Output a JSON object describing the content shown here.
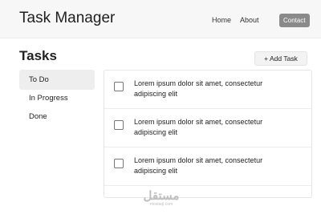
{
  "header": {
    "title": "Task Manager",
    "nav": {
      "home": "Home",
      "about": "About",
      "contact": "Contact"
    }
  },
  "page": {
    "title": "Tasks",
    "add_button": "+ Add Task"
  },
  "sidebar": {
    "items": [
      {
        "label": "To Do",
        "active": true
      },
      {
        "label": "In Progress",
        "active": false
      },
      {
        "label": "Done",
        "active": false
      }
    ]
  },
  "tasks": [
    {
      "text": "Lorem ipsum dolor sit amet, consectetur adipiscing elit",
      "done": false
    },
    {
      "text": "Lorem ipsum dolor sit amet, consectetur adipiscing elit",
      "done": false
    },
    {
      "text": "Lorem ipsum dolor sit amet, consectetur adipiscing elit",
      "done": false
    }
  ],
  "watermark": {
    "mark": "مستقل",
    "text": "mostaql.com"
  },
  "colors": {
    "header_bg": "#f7f7f7",
    "contact_bg": "#8a8a8a",
    "active_item_bg": "#eeeeee"
  }
}
